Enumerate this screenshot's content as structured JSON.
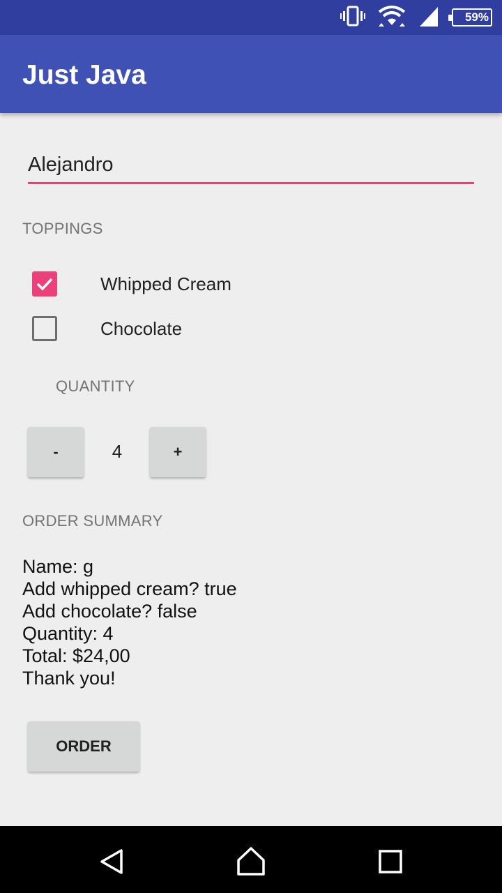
{
  "status_bar": {
    "battery_text": "59%",
    "icons": [
      "vibrate-icon",
      "wifi-icon",
      "signal-icon",
      "battery-icon"
    ]
  },
  "app_bar": {
    "title": "Just Java"
  },
  "name_field": {
    "value": "Alejandro"
  },
  "toppings": {
    "label": "TOPPINGS",
    "items": [
      {
        "label": "Whipped Cream",
        "checked": true
      },
      {
        "label": "Chocolate",
        "checked": false
      }
    ]
  },
  "quantity": {
    "label": "QUANTITY",
    "decrement_label": "-",
    "increment_label": "+",
    "value": "4"
  },
  "order_summary": {
    "label": "ORDER SUMMARY",
    "lines": [
      "Name: g",
      "Add whipped cream? true",
      "Add chocolate? false",
      "Quantity: 4",
      "Total: $24,00",
      "Thank you!"
    ]
  },
  "order_button": {
    "label": "ORDER"
  },
  "nav_bar": {
    "buttons": [
      "back-icon",
      "home-icon",
      "recents-icon"
    ]
  },
  "colors": {
    "primary": "#3f51b5",
    "primary_dark": "#303f9f",
    "accent": "#ec407a",
    "background": "#eeeeee"
  }
}
